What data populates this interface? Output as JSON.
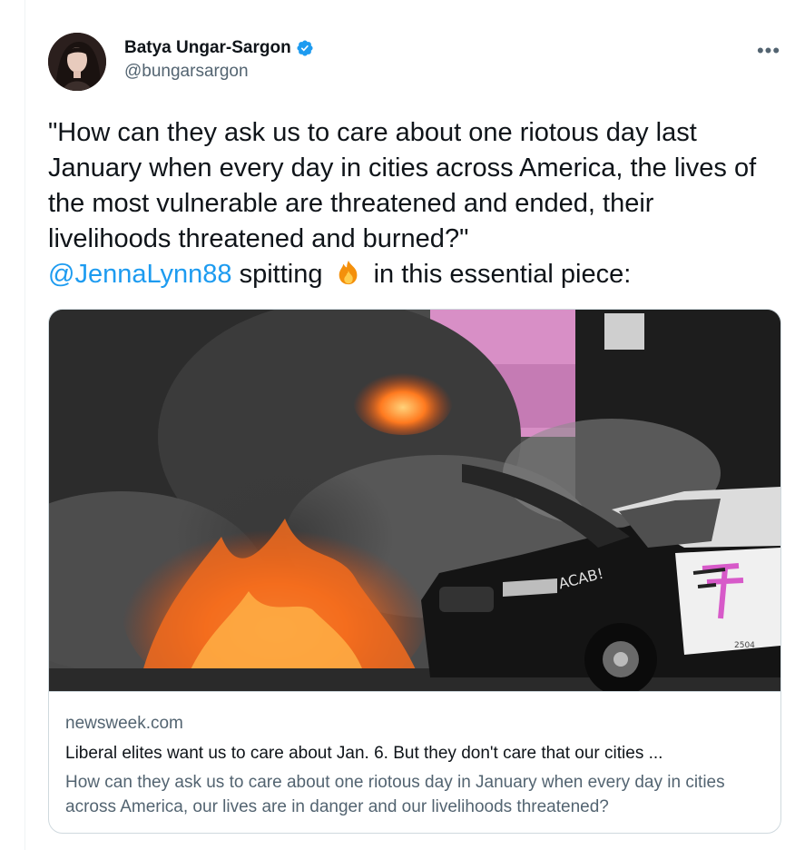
{
  "author": {
    "display_name": "Batya Ungar-Sargon",
    "handle": "@bungarsargon",
    "verified": true
  },
  "tweet": {
    "text_before": "\"How can they ask us to care about one riotous day last January when every day in cities across America, the lives of the most vulnerable are threatened and ended, their livelihoods threatened and burned?\"",
    "mention": "@JennaLynn88",
    "text_middle": " spitting ",
    "emoji": "fire",
    "text_after": " in this essential piece:"
  },
  "card": {
    "domain": "newsweek.com",
    "title": "Liberal elites want us to care about Jan. 6. But they don't care that our cities ...",
    "description": "How can they ask us to care about one riotous day in January when every day in cities across America, our lives are in danger and our livelihoods threatened?",
    "image_graffiti_text": "ACAB!",
    "image_car_number": "2504"
  },
  "icons": {
    "more": "more-horizontal-icon",
    "verified": "verified-badge-icon"
  },
  "colors": {
    "link": "#1d9bf0",
    "secondary_text": "#536471",
    "border": "#cfd9de"
  }
}
